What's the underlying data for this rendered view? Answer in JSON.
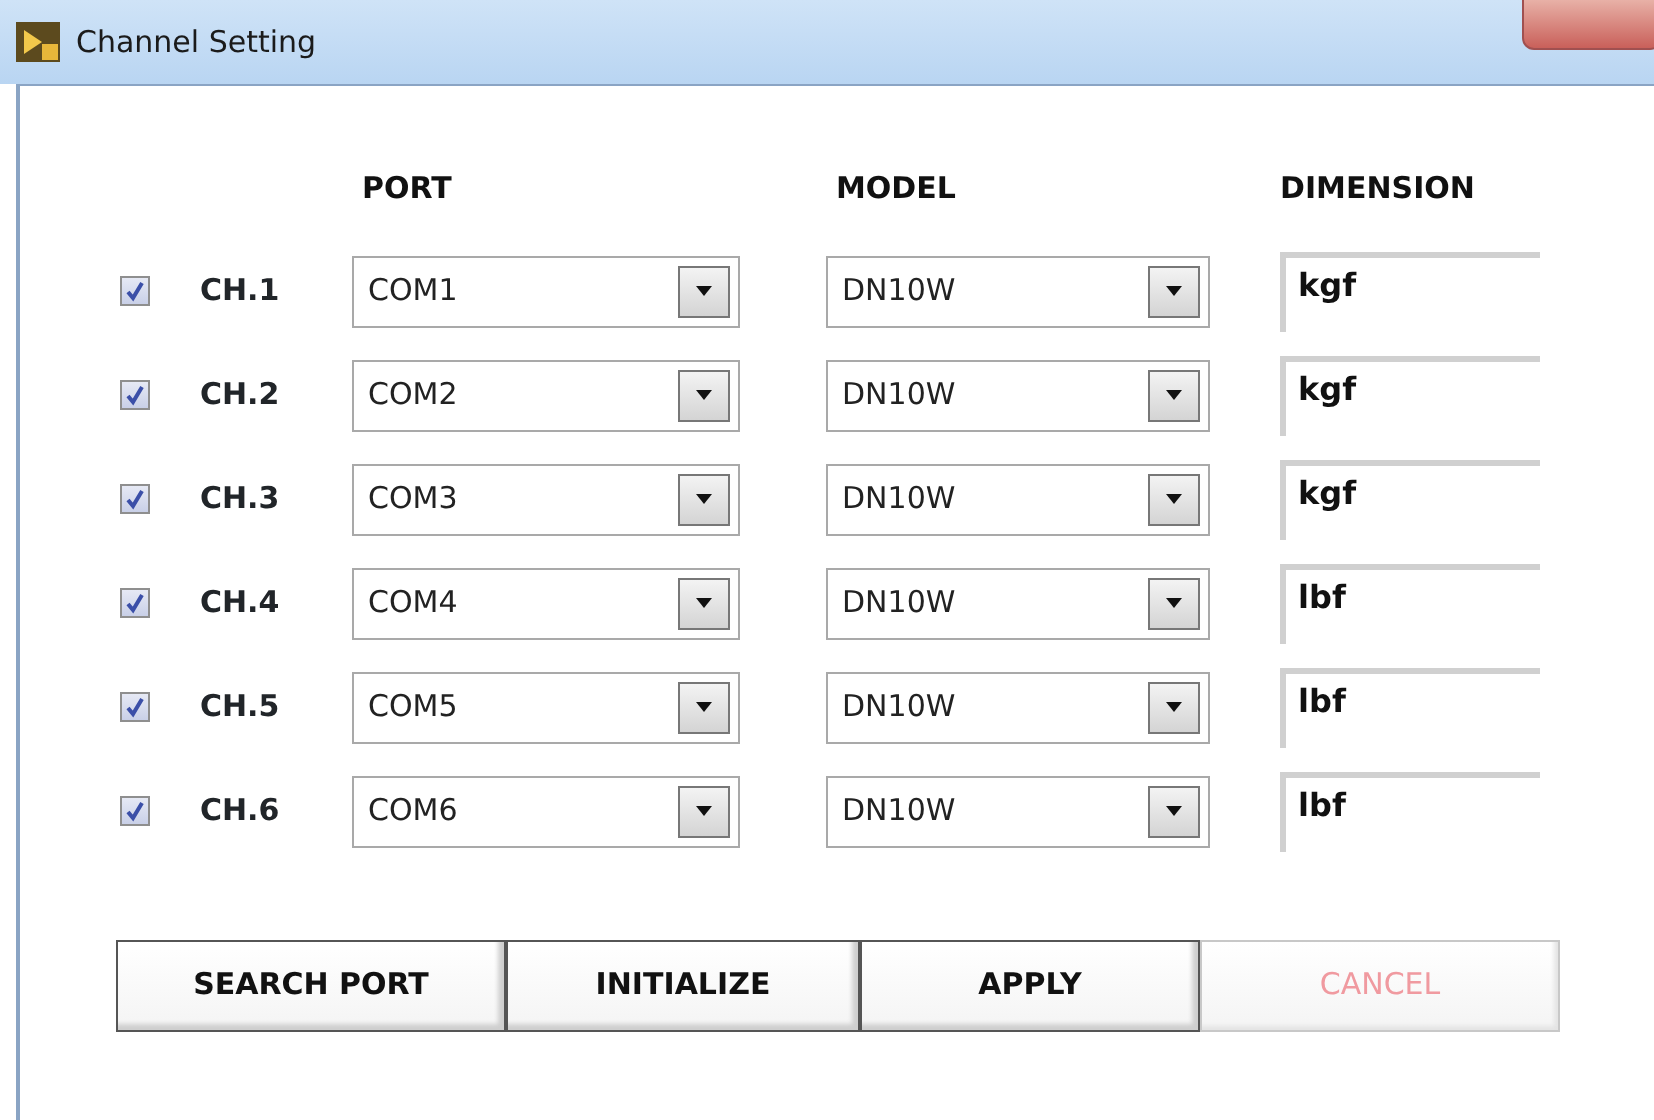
{
  "window": {
    "title": "Channel Setting"
  },
  "headers": [
    "PORT",
    "MODEL",
    "DIMENSION"
  ],
  "channels": [
    {
      "label": "CH.1",
      "checked": true,
      "port": "COM1",
      "model": "DN10W",
      "dimension": "kgf"
    },
    {
      "label": "CH.2",
      "checked": true,
      "port": "COM2",
      "model": "DN10W",
      "dimension": "kgf"
    },
    {
      "label": "CH.3",
      "checked": true,
      "port": "COM3",
      "model": "DN10W",
      "dimension": "kgf"
    },
    {
      "label": "CH.4",
      "checked": true,
      "port": "COM4",
      "model": "DN10W",
      "dimension": "lbf"
    },
    {
      "label": "CH.5",
      "checked": true,
      "port": "COM5",
      "model": "DN10W",
      "dimension": "lbf"
    },
    {
      "label": "CH.6",
      "checked": true,
      "port": "COM6",
      "model": "DN10W",
      "dimension": "lbf"
    }
  ],
  "buttons": [
    {
      "label": "SEARCH PORT",
      "disabled": false
    },
    {
      "label": "INITIALIZE",
      "disabled": false
    },
    {
      "label": "APPLY",
      "disabled": false
    },
    {
      "label": "CANCEL",
      "disabled": true
    }
  ]
}
